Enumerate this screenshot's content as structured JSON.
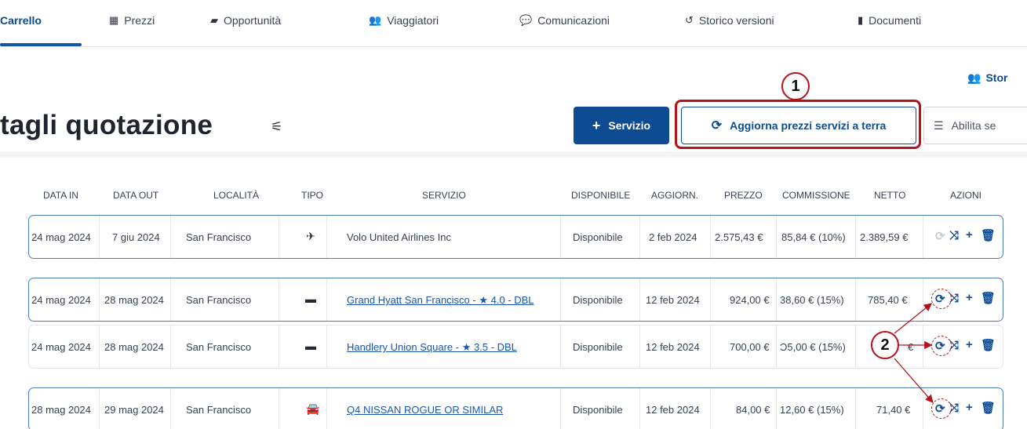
{
  "nav": {
    "tabs": [
      {
        "label": "Carrello",
        "icon": "cart-icon"
      },
      {
        "label": "Prezzi",
        "icon": "calculator-icon",
        "glyph": "▦"
      },
      {
        "label": "Opportunità",
        "icon": "folder-icon",
        "glyph": "▰"
      },
      {
        "label": "Viaggiatori",
        "icon": "users-icon",
        "glyph": "👥"
      },
      {
        "label": "Comunicazioni",
        "icon": "chat-icon",
        "glyph": "💬"
      },
      {
        "label": "Storico versioni",
        "icon": "history-icon",
        "glyph": "↺"
      },
      {
        "label": "Documenti",
        "icon": "document-icon",
        "glyph": "▮"
      }
    ]
  },
  "header": {
    "title": "tagli quotazione",
    "story_link": "Stor",
    "add_service_label": "Servizio",
    "refresh_label": "Aggiorna prezzi servizi a terra",
    "enable_label": "Abilita se"
  },
  "annotations": {
    "badge1": "1",
    "badge2": "2"
  },
  "table": {
    "headers": [
      "DATA IN",
      "DATA OUT",
      "LOCALITÀ",
      "TIPO",
      "SERVIZIO",
      "DISPONIBILE",
      "AGGIORN.",
      "PREZZO",
      "COMMISSIONE",
      "NETTO",
      "AZIONI"
    ],
    "rows": [
      {
        "data_in": "24 mag 2024",
        "data_out": "7 giu 2024",
        "localita": "San Francisco",
        "tipo": "flight-icon",
        "servizio": "Volo United Airlines Inc",
        "disponibile": "Disponibile",
        "aggiorn": "2 feb 2024",
        "prezzo": "2.575,43 €",
        "commissione": "85,84 € (10%)",
        "netto": "2.389,59 €"
      },
      {
        "data_in": "24 mag 2024",
        "data_out": "28 mag 2024",
        "localita": "San Francisco",
        "tipo": "bed-icon",
        "servizio": "Grand Hyatt San Francisco - ★ 4.0 - DBL",
        "disponibile": "Disponibile",
        "aggiorn": "12 feb 2024",
        "prezzo": "924,00 €",
        "commissione": "38,60 € (15%)",
        "netto": "785,40 €"
      },
      {
        "data_in": "24 mag 2024",
        "data_out": "28 mag 2024",
        "localita": "San Francisco",
        "tipo": "bed-icon",
        "servizio": "Handlery Union Square - ★ 3.5 - DBL",
        "disponibile": "Disponibile",
        "aggiorn": "12 feb 2024",
        "prezzo": "700,00 €",
        "commissione": "Ͻ5,00 € (15%)",
        "netto": "€"
      },
      {
        "data_in": "28 mag 2024",
        "data_out": "29 mag 2024",
        "localita": "San Francisco",
        "tipo": "car-icon",
        "servizio": "Q4 NISSAN ROGUE OR SIMILAR",
        "disponibile": "Disponibile",
        "aggiorn": "12 feb 2024",
        "prezzo": "84,00 €",
        "commissione": "12,60 € (15%)",
        "netto": "71,40 €"
      }
    ]
  },
  "colors": {
    "brand": "#0d4c93",
    "annotation": "#b5121b",
    "row_border": "#4a7ec2"
  }
}
